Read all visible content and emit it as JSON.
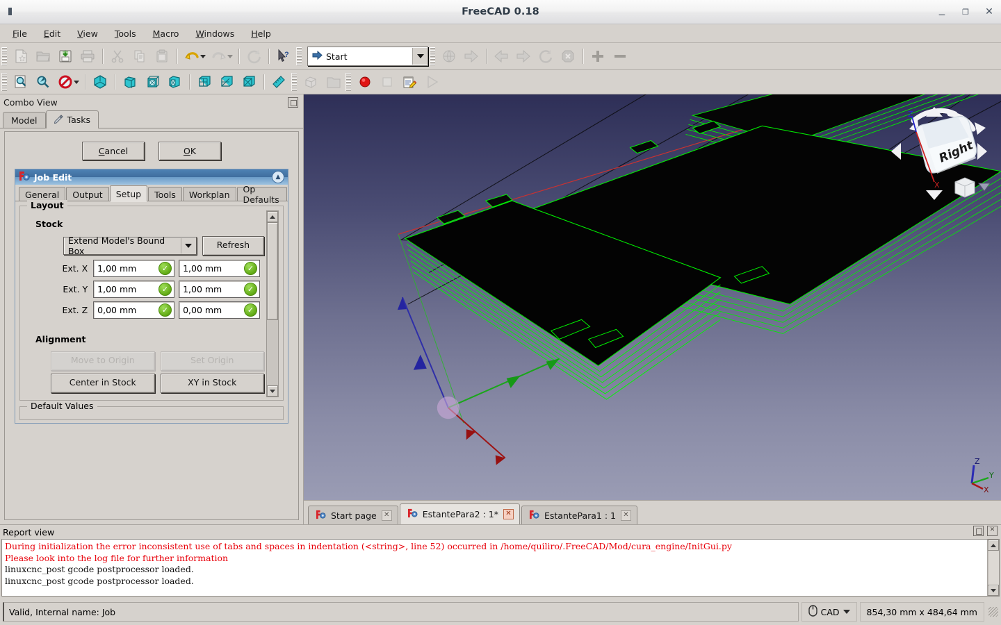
{
  "window": {
    "title": "FreeCAD 0.18",
    "app_icon": "freecad-icon",
    "controls": {
      "minimize": "‒",
      "maximize": "❐",
      "close": "✕"
    }
  },
  "menubar": {
    "items": [
      {
        "label": "File",
        "mnemonic": "F"
      },
      {
        "label": "Edit",
        "mnemonic": "E"
      },
      {
        "label": "View",
        "mnemonic": "V"
      },
      {
        "label": "Tools",
        "mnemonic": "T"
      },
      {
        "label": "Macro",
        "mnemonic": "M"
      },
      {
        "label": "Windows",
        "mnemonic": "W"
      },
      {
        "label": "Help",
        "mnemonic": "H"
      }
    ]
  },
  "toolbars": {
    "file": [
      {
        "name": "new-document-button",
        "icon": "new-file-icon",
        "enabled": false
      },
      {
        "name": "open-document-button",
        "icon": "open-folder-icon",
        "enabled": false
      },
      {
        "name": "save-document-button",
        "icon": "save-icon",
        "enabled": true
      },
      {
        "name": "print-document-button",
        "icon": "printer-icon",
        "enabled": false
      }
    ],
    "edit": [
      {
        "name": "cut-button",
        "icon": "scissors-icon",
        "enabled": false
      },
      {
        "name": "copy-button",
        "icon": "copy-icon",
        "enabled": false
      },
      {
        "name": "paste-button",
        "icon": "clipboard-icon",
        "enabled": false
      },
      {
        "name": "undo-button",
        "icon": "undo-arrow-icon",
        "enabled": true
      },
      {
        "name": "redo-button",
        "icon": "redo-arrow-icon",
        "enabled": false
      },
      {
        "name": "refresh-button",
        "icon": "refresh-icon",
        "enabled": false
      },
      {
        "name": "whats-this-button",
        "icon": "cursor-question-icon",
        "enabled": true
      }
    ],
    "workbench": {
      "selected": "Start",
      "icon": "start-arrow-icon"
    },
    "navigation": [
      {
        "name": "web-home-button",
        "icon": "globe-icon",
        "enabled": false
      },
      {
        "name": "web-go-button",
        "icon": "arrow-right-icon",
        "enabled": false
      },
      {
        "name": "nav-back-button",
        "icon": "arrow-left-icon",
        "enabled": false
      },
      {
        "name": "nav-forward-button",
        "icon": "arrow-right-icon",
        "enabled": false
      },
      {
        "name": "nav-reload-button",
        "icon": "reload-icon",
        "enabled": false
      },
      {
        "name": "nav-stop-button",
        "icon": "stop-x-icon",
        "enabled": false
      },
      {
        "name": "zoom-in-button",
        "icon": "plus-icon",
        "enabled": true
      },
      {
        "name": "zoom-out-button",
        "icon": "minus-icon",
        "enabled": true
      }
    ],
    "view": [
      {
        "name": "fit-all-button",
        "icon": "fit-all-icon",
        "enabled": true
      },
      {
        "name": "fit-selection-button",
        "icon": "zoom-fit-icon",
        "enabled": true
      },
      {
        "name": "draw-style-button",
        "icon": "no-draw-style-icon",
        "enabled": true
      },
      {
        "name": "axonometric-view-button",
        "icon": "iso-cube-icon",
        "enabled": true
      },
      {
        "name": "front-view-button",
        "icon": "cube-front-icon",
        "enabled": true
      },
      {
        "name": "top-view-button",
        "icon": "cube-top-icon",
        "enabled": true
      },
      {
        "name": "right-view-button",
        "icon": "cube-right-icon",
        "enabled": true
      },
      {
        "name": "rear-view-button",
        "icon": "cube-rear-icon",
        "enabled": true
      },
      {
        "name": "bottom-view-button",
        "icon": "cube-bottom-icon",
        "enabled": true
      },
      {
        "name": "left-view-button",
        "icon": "cube-left-icon",
        "enabled": true
      },
      {
        "name": "measure-button",
        "icon": "ruler-icon",
        "enabled": true
      }
    ],
    "structure": [
      {
        "name": "create-part-button",
        "icon": "part-icon",
        "enabled": false
      },
      {
        "name": "create-group-button",
        "icon": "folder-icon",
        "enabled": false
      }
    ],
    "macro": [
      {
        "name": "macro-record-button",
        "icon": "record-red-circle-icon",
        "enabled": true
      },
      {
        "name": "macro-stop-button",
        "icon": "stop-square-icon",
        "enabled": false
      },
      {
        "name": "macro-edit-button",
        "icon": "notepad-pencil-icon",
        "enabled": true
      },
      {
        "name": "macro-execute-button",
        "icon": "play-triangle-icon",
        "enabled": false
      }
    ]
  },
  "combo_view": {
    "title": "Combo View",
    "float_icon": "float-panel-icon",
    "tabs": [
      {
        "label": "Model",
        "icon": "",
        "active": false
      },
      {
        "label": "Tasks",
        "icon": "pencil-icon",
        "active": true
      }
    ],
    "task_buttons": {
      "cancel": "Cancel",
      "cancel_mnemonic": "C",
      "ok": "OK",
      "ok_mnemonic": "O"
    },
    "job_edit": {
      "title": "Job Edit",
      "icon": "freecad-job-icon",
      "collapse_icon": "chevron-up-icon",
      "tabs": [
        {
          "label": "General",
          "active": false
        },
        {
          "label": "Output",
          "active": false
        },
        {
          "label": "Setup",
          "active": true
        },
        {
          "label": "Tools",
          "active": false
        },
        {
          "label": "Workplan",
          "active": false
        },
        {
          "label": "Op Defaults",
          "active": false
        }
      ],
      "layout_group": "Layout",
      "stock": {
        "title": "Stock",
        "mode": "Extend Model's Bound Box",
        "refresh_label": "Refresh",
        "fields": [
          {
            "label": "Ext. X",
            "neg": "1,00 mm",
            "pos": "1,00 mm",
            "valid": true
          },
          {
            "label": "Ext. Y",
            "neg": "1,00 mm",
            "pos": "1,00 mm",
            "valid": true
          },
          {
            "label": "Ext. Z",
            "neg": "0,00 mm",
            "pos": "0,00 mm",
            "valid": true
          }
        ]
      },
      "alignment": {
        "title": "Alignment",
        "buttons": [
          {
            "label": "Move to Origin",
            "enabled": false
          },
          {
            "label": "Set Origin",
            "enabled": false
          },
          {
            "label": "Center in Stock",
            "enabled": true
          },
          {
            "label": "XY in Stock",
            "enabled": true
          }
        ]
      },
      "default_values_group": "Default Values"
    }
  },
  "viewport": {
    "nav_cube_face": "Right",
    "axis_labels": {
      "x": "X",
      "y": "Y",
      "z": "Z"
    },
    "nav_axis_labels": {
      "x": "X",
      "z": "Z"
    },
    "colors": {
      "x_axis": "#cc1111",
      "y_axis": "#11bb22",
      "z_axis": "#2222cc",
      "model_edge": "#00ff00",
      "model_face": "#000000",
      "background_top": "#2e2f57",
      "background_bottom": "#9a9cb4"
    },
    "document_tabs": [
      {
        "label": "Start page",
        "active": false,
        "modified": false
      },
      {
        "label": "EstantePara2 : 1*",
        "active": true,
        "modified": true
      },
      {
        "label": "EstantePara1 : 1",
        "active": false,
        "modified": false
      }
    ]
  },
  "report_view": {
    "title": "Report view",
    "float_icon": "float-panel-icon",
    "close_icon": "close-panel-icon",
    "lines": [
      {
        "text": "During initialization the error inconsistent use of tabs and spaces in indentation (<string>, line 52) occurred in /home/quiliro/.FreeCAD/Mod/cura_engine/InitGui.py",
        "level": "error"
      },
      {
        "text": "Please look into the log file for further information",
        "level": "error"
      },
      {
        "text": "linuxcnc_post gcode postprocessor loaded.",
        "level": "info"
      },
      {
        "text": "linuxcnc_post gcode postprocessor loaded.",
        "level": "info"
      }
    ],
    "error_color": "#e8000a"
  },
  "statusbar": {
    "message": "Valid, Internal name: Job",
    "navigation_style": "CAD",
    "navigation_icon": "mouse-icon",
    "dimensions": "854,30 mm x 484,64 mm"
  }
}
